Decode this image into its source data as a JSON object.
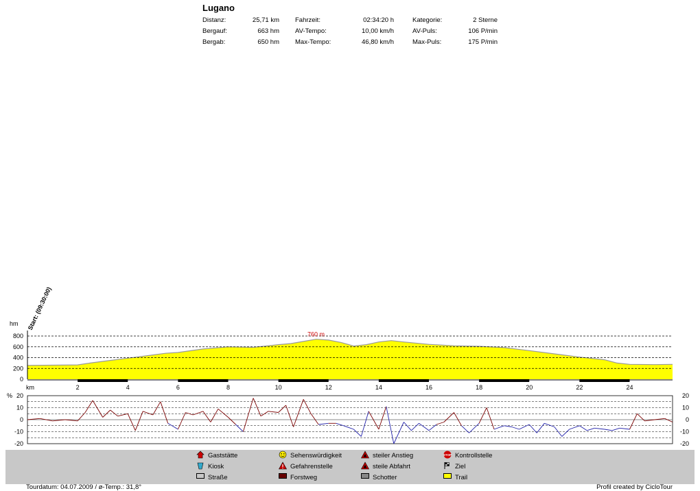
{
  "header": {
    "title": "Lugano",
    "stats": [
      [
        {
          "label": "Distanz:",
          "value": "25,71 km"
        },
        {
          "label": "Fahrzeit:",
          "value": "02:34:20 h"
        },
        {
          "label": "Kategorie:",
          "value": "2 Sterne"
        }
      ],
      [
        {
          "label": "Bergauf:",
          "value": "663 hm"
        },
        {
          "label": "AV-Tempo:",
          "value": "10,00 km/h"
        },
        {
          "label": "AV-Puls:",
          "value": "106 P/min"
        }
      ],
      [
        {
          "label": "Bergab:",
          "value": "650 hm"
        },
        {
          "label": "Max-Tempo:",
          "value": "46,80 km/h"
        },
        {
          "label": "Max-Puls:",
          "value": "175 P/min"
        }
      ]
    ]
  },
  "chart_data": [
    {
      "type": "area",
      "start_label": "Start: (09:30:00)",
      "ylabel": "hm",
      "xlabel": "km",
      "ylim": [
        0,
        800
      ],
      "xlim": [
        0,
        25.71
      ],
      "yticks": [
        "0",
        "200",
        "400",
        "600",
        "800"
      ],
      "xticks": [
        "2",
        "4",
        "6",
        "8",
        "10",
        "12",
        "14",
        "16",
        "18",
        "20",
        "22",
        "24"
      ],
      "max_label": "760 m",
      "grid": true,
      "series": [
        {
          "x": [
            0,
            1,
            2,
            2.5,
            3,
            4,
            5,
            5.5,
            6,
            7,
            8,
            9,
            10,
            10.5,
            11,
            11.5,
            12,
            12.5,
            13,
            13.5,
            14,
            14.5,
            15,
            16,
            17,
            18,
            19,
            20,
            21,
            22,
            23,
            23.5,
            24,
            25,
            25.71
          ],
          "y": [
            255,
            260,
            265,
            300,
            330,
            390,
            450,
            480,
            495,
            560,
            600,
            590,
            640,
            660,
            700,
            740,
            725,
            680,
            615,
            640,
            690,
            715,
            690,
            645,
            620,
            610,
            585,
            530,
            470,
            410,
            360,
            300,
            275,
            270,
            275
          ]
        }
      ],
      "surface_segments": [
        [
          2,
          4
        ],
        [
          6,
          8
        ],
        [
          10,
          12
        ],
        [
          14,
          16
        ],
        [
          18,
          20
        ],
        [
          22,
          24
        ]
      ]
    },
    {
      "type": "line",
      "ylabel": "%",
      "ylim": [
        -20,
        20
      ],
      "yticks": [
        "20",
        "10",
        "0",
        "-10",
        "-20"
      ],
      "series": [
        {
          "x": [
            0,
            0.5,
            1,
            1.5,
            2,
            2.3,
            2.6,
            3,
            3.3,
            3.6,
            4,
            4.3,
            4.6,
            5,
            5.3,
            5.6,
            6,
            6.3,
            6.6,
            7,
            7.3,
            7.6,
            8,
            8.3,
            8.6,
            9,
            9.3,
            9.6,
            10,
            10.3,
            10.6,
            11,
            11.3,
            11.6,
            12,
            12.3,
            12.6,
            13,
            13.3,
            13.6,
            14,
            14.3,
            14.6,
            15,
            15.3,
            15.6,
            16,
            16.3,
            16.6,
            17,
            17.3,
            17.6,
            18,
            18.3,
            18.6,
            19,
            19.3,
            19.6,
            20,
            20.3,
            20.6,
            21,
            21.3,
            21.6,
            22,
            22.3,
            22.6,
            23,
            23.3,
            23.6,
            24,
            24.3,
            24.6,
            25,
            25.4,
            25.71
          ],
          "y": [
            0,
            1,
            -1,
            0,
            -1,
            6,
            16,
            2,
            8,
            3,
            5,
            -9,
            7,
            4,
            15,
            -3,
            -8,
            6,
            4,
            7,
            -2,
            9,
            2,
            -4,
            -10,
            18,
            3,
            7,
            6,
            12,
            -6,
            17,
            5,
            -4,
            -3,
            -3,
            -5,
            -8,
            -14,
            7,
            -8,
            11,
            -20,
            -2,
            -9,
            -3,
            -9,
            -4,
            -2,
            6,
            -5,
            -11,
            -3,
            10,
            -8,
            -5,
            -6,
            -8,
            -4,
            -11,
            -3,
            -6,
            -14,
            -8,
            -5,
            -9,
            -7,
            -8,
            -9,
            -7,
            -8,
            5,
            -1,
            0,
            1,
            -2
          ]
        }
      ]
    }
  ],
  "legend": {
    "items": [
      {
        "label": "Gaststätte",
        "icon": "house-icon",
        "color": "#cc0000"
      },
      {
        "label": "Kiosk",
        "icon": "cup-icon",
        "color": "#33aacc"
      },
      {
        "label": "Straße",
        "icon": "street-swatch",
        "color": "#c8c8c8"
      },
      {
        "label": "Sehenswürdigkeit",
        "icon": "smiley-icon",
        "color": "#ffee00"
      },
      {
        "label": "Gefahrenstelle",
        "icon": "warning-icon",
        "color": "#cc0000"
      },
      {
        "label": "Forstweg",
        "icon": "forest-swatch",
        "color": "#660000"
      },
      {
        "label": "steiler Anstieg",
        "icon": "steep-up-icon",
        "color": "#cc0000"
      },
      {
        "label": "steile Abfahrt",
        "icon": "steep-down-icon",
        "color": "#cc0000"
      },
      {
        "label": "Schotter",
        "icon": "gravel-swatch",
        "color": "#888888"
      },
      {
        "label": "Kontrollstelle",
        "icon": "stop-icon",
        "color": "#cc0000"
      },
      {
        "label": "Ziel",
        "icon": "flag-icon",
        "color": "#000000"
      },
      {
        "label": "Trail",
        "icon": "trail-swatch",
        "color": "#ffff00"
      }
    ]
  },
  "footer": {
    "left": "Tourdatum: 04.07.2009  /  ø-Temp.: 31,8°",
    "right": "Profil created by CicloTour"
  }
}
